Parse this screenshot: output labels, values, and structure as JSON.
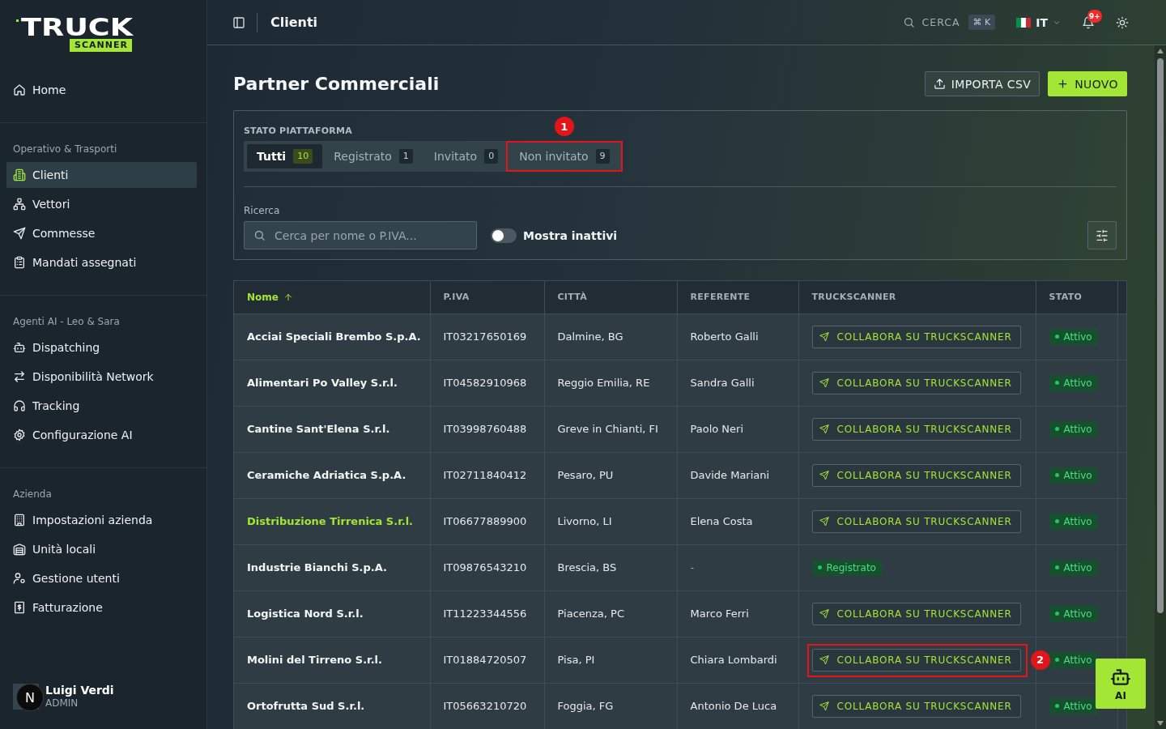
{
  "sidebar": {
    "logo": {
      "word": "TRUCK",
      "tag": "SCANNER"
    },
    "sections": [
      {
        "items": [
          {
            "label": "Home",
            "selected": false
          }
        ]
      },
      {
        "title": "Operativo & Trasporti",
        "items": [
          {
            "label": "Clienti",
            "selected": true
          },
          {
            "label": "Vettori",
            "selected": false
          },
          {
            "label": "Commesse",
            "selected": false
          },
          {
            "label": "Mandati assegnati",
            "selected": false
          }
        ]
      },
      {
        "title": "Agenti AI - Leo & Sara",
        "items": [
          {
            "label": "Dispatching",
            "selected": false
          },
          {
            "label": "Disponibilità Network",
            "selected": false
          },
          {
            "label": "Tracking",
            "selected": false
          },
          {
            "label": "Configurazione AI",
            "selected": false
          }
        ]
      },
      {
        "title": "Azienda",
        "items": [
          {
            "label": "Impostazioni azienda",
            "selected": false
          },
          {
            "label": "Unità locali",
            "selected": false
          },
          {
            "label": "Gestione utenti",
            "selected": false
          },
          {
            "label": "Fatturazione",
            "selected": false
          }
        ]
      }
    ],
    "user": {
      "name": "Luigi Verdi",
      "role": "ADMIN"
    }
  },
  "topbar": {
    "title": "Clienti",
    "search": {
      "label": "CERCA",
      "shortcut": "⌘ K"
    },
    "language": "IT",
    "notifications": {
      "badge": "9+"
    }
  },
  "page": {
    "title": "Partner Commerciali",
    "actions": [
      {
        "label": "IMPORTA CSV",
        "kind": "import"
      },
      {
        "label": "NUOVO",
        "kind": "create"
      }
    ]
  },
  "filters": {
    "label": "STATO PIATTAFORMA",
    "tabs": [
      {
        "label": "Tutti",
        "count": "10",
        "selected": true
      },
      {
        "label": "Registrato",
        "count": "1",
        "selected": false
      },
      {
        "label": "Invitato",
        "count": "0",
        "selected": false
      },
      {
        "label": "Non invitato",
        "count": "9",
        "selected": false,
        "callout": "1"
      }
    ],
    "search": {
      "label": "Ricerca",
      "placeholder": "Cerca per nome o P.IVA..."
    },
    "toggle": {
      "label": "Mostra inattivi",
      "on": false
    }
  },
  "table": {
    "columns": [
      {
        "label": "Nome",
        "sorted": true
      },
      {
        "label": "P.IVA",
        "sorted": false
      },
      {
        "label": "CITTÀ",
        "sorted": false
      },
      {
        "label": "REFERENTE",
        "sorted": false
      },
      {
        "label": "TRUCKSCANNER",
        "sorted": false
      },
      {
        "label": "STATO",
        "sorted": false
      }
    ],
    "rows": [
      {
        "name": "Acciai Speciali Brembo S.p.A.",
        "vat": "IT03217650169",
        "city": "Dalmine, BG",
        "contact": "Roberto Galli",
        "truckscanner": {
          "kind": "invite",
          "label": "COLLABORA SU TRUCKSCANNER"
        },
        "status": "Attivo",
        "highlighted": false
      },
      {
        "name": "Alimentari Po Valley S.r.l.",
        "vat": "IT04582910968",
        "city": "Reggio Emilia, RE",
        "contact": "Sandra Galli",
        "truckscanner": {
          "kind": "invite",
          "label": "COLLABORA SU TRUCKSCANNER"
        },
        "status": "Attivo",
        "highlighted": false
      },
      {
        "name": "Cantine Sant'Elena S.r.l.",
        "vat": "IT03998760488",
        "city": "Greve in Chianti, FI",
        "contact": "Paolo Neri",
        "truckscanner": {
          "kind": "invite",
          "label": "COLLABORA SU TRUCKSCANNER"
        },
        "status": "Attivo",
        "highlighted": false
      },
      {
        "name": "Ceramiche Adriatica S.p.A.",
        "vat": "IT02711840412",
        "city": "Pesaro, PU",
        "contact": "Davide Mariani",
        "truckscanner": {
          "kind": "invite",
          "label": "COLLABORA SU TRUCKSCANNER"
        },
        "status": "Attivo",
        "highlighted": false
      },
      {
        "name": "Distribuzione Tirrenica S.r.l.",
        "vat": "IT06677889900",
        "city": "Livorno, LI",
        "contact": "Elena Costa",
        "truckscanner": {
          "kind": "invite",
          "label": "COLLABORA SU TRUCKSCANNER"
        },
        "status": "Attivo",
        "highlighted": true
      },
      {
        "name": "Industrie Bianchi S.p.A.",
        "vat": "IT09876543210",
        "city": "Brescia, BS",
        "contact": "-",
        "truckscanner": {
          "kind": "status",
          "label": "Registrato"
        },
        "status": "Attivo",
        "highlighted": false
      },
      {
        "name": "Logistica Nord S.r.l.",
        "vat": "IT11223344556",
        "city": "Piacenza, PC",
        "contact": "Marco Ferri",
        "truckscanner": {
          "kind": "invite",
          "label": "COLLABORA SU TRUCKSCANNER"
        },
        "status": "Attivo",
        "highlighted": false
      },
      {
        "name": "Molini del Tirreno S.r.l.",
        "vat": "IT01884720507",
        "city": "Pisa, PI",
        "contact": "Chiara Lombardi",
        "truckscanner": {
          "kind": "invite",
          "label": "COLLABORA SU TRUCKSCANNER",
          "callout": "2"
        },
        "status": "Attivo",
        "highlighted": false
      },
      {
        "name": "Ortofrutta Sud S.r.l.",
        "vat": "IT05663210720",
        "city": "Foggia, FG",
        "contact": "Antonio De Luca",
        "truckscanner": {
          "kind": "invite",
          "label": "COLLABORA SU TRUCKSCANNER"
        },
        "status": "Attivo",
        "highlighted": false
      }
    ]
  },
  "assistant_button": {
    "label": "AI"
  },
  "dev_badge": {
    "label": "N"
  }
}
